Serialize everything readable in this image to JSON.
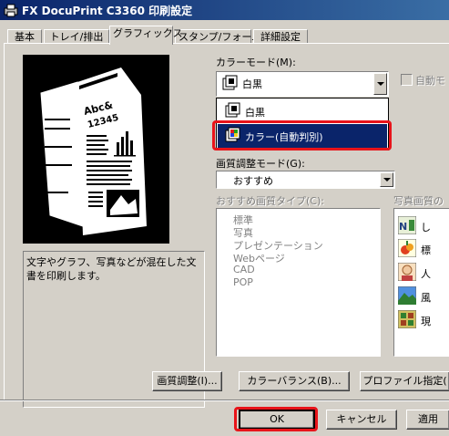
{
  "window": {
    "title": "FX DocuPrint C3360 印刷設定"
  },
  "tabs": [
    {
      "label": "基本"
    },
    {
      "label": "トレイ/排出"
    },
    {
      "label": "グラフィックス"
    },
    {
      "label": "スタンプ/フォーム"
    },
    {
      "label": "詳細設定"
    }
  ],
  "preview": {
    "doc_title": "Abc&\n12345",
    "description": "文字やグラフ、写真などが混在した文書を印刷します。"
  },
  "color_mode": {
    "label": "カラーモード(M):",
    "selected": "白黒",
    "options": [
      "白黒",
      "カラー(自動判別)"
    ],
    "highlighted": "カラー(自動判別)",
    "auto_checkbox_label": "自動モ"
  },
  "quality_mode": {
    "label": "画質調整モード(G):",
    "selected": "おすすめ"
  },
  "recommended_types": {
    "label": "おすすめ画質タイプ(C):",
    "items": [
      "標準",
      "写真",
      "プレゼンテーション",
      "Webページ",
      "CAD",
      "POP"
    ]
  },
  "photo_quality": {
    "label": "写真画質の",
    "items": [
      {
        "label": "し",
        "icon": "text-photo-icon"
      },
      {
        "label": "標",
        "icon": "fruit-icon"
      },
      {
        "label": "人",
        "icon": "person-icon"
      },
      {
        "label": "風",
        "icon": "landscape-icon"
      },
      {
        "label": "現",
        "icon": "grid-icon"
      }
    ]
  },
  "buttons": {
    "quality_adjust": "画質調整(I)...",
    "color_balance": "カラーバランス(B)...",
    "profile": "プロファイル指定(",
    "ok": "OK",
    "cancel": "キャンセル",
    "apply": "適用"
  },
  "colors": {
    "titlebar_start": "#0a246a",
    "selection": "#0a246a",
    "highlight_box": "#e8141a",
    "dialog_bg": "#d4d0c8"
  }
}
